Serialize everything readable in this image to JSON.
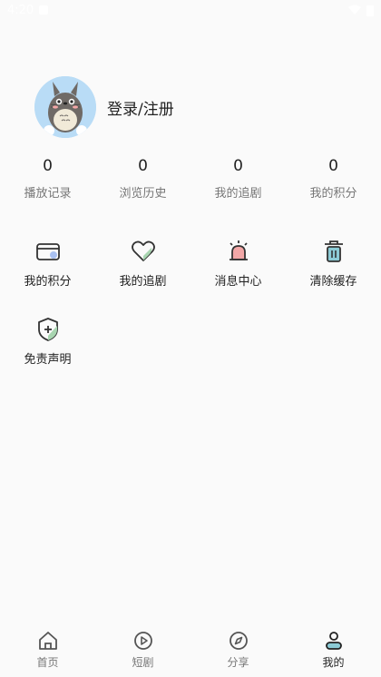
{
  "status_bar": {
    "time": "4:20"
  },
  "profile": {
    "login_label": "登录/注册"
  },
  "stats": [
    {
      "value": "0",
      "label": "播放记录"
    },
    {
      "value": "0",
      "label": "浏览历史"
    },
    {
      "value": "0",
      "label": "我的追剧"
    },
    {
      "value": "0",
      "label": "我的积分"
    }
  ],
  "menu": [
    {
      "label": "我的积分",
      "icon": "card-icon"
    },
    {
      "label": "我的追剧",
      "icon": "heart-icon"
    },
    {
      "label": "消息中心",
      "icon": "alarm-icon"
    },
    {
      "label": "清除缓存",
      "icon": "trash-icon"
    },
    {
      "label": "免责声明",
      "icon": "shield-icon"
    }
  ],
  "tabbar": [
    {
      "label": "首页",
      "icon": "home-icon"
    },
    {
      "label": "短剧",
      "icon": "play-icon"
    },
    {
      "label": "分享",
      "icon": "compass-icon"
    },
    {
      "label": "我的",
      "icon": "user-icon",
      "active": true
    }
  ],
  "colors": {
    "background": "#fafafa",
    "avatar_bg": "#b9dcf6",
    "label_gray": "#777777",
    "icon_green": "#a8d5b0",
    "icon_blue": "#a9c1f2",
    "icon_red": "#f2a7a7",
    "icon_teal": "#8ccbd6"
  }
}
